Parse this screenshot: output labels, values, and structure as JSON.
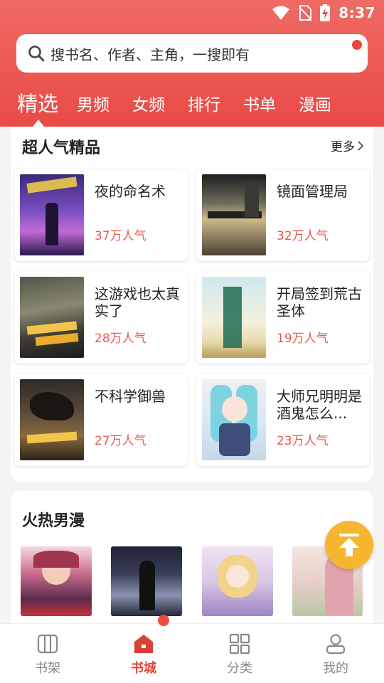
{
  "status_bar": {
    "time": "8:37",
    "icons": [
      "wifi-icon",
      "no-sim-icon",
      "battery-charging-icon"
    ]
  },
  "search": {
    "placeholder": "搜书名、作者、主角，一搜即有"
  },
  "tabs": [
    {
      "label": "精选",
      "active": true
    },
    {
      "label": "男频"
    },
    {
      "label": "女频"
    },
    {
      "label": "排行"
    },
    {
      "label": "书单"
    },
    {
      "label": "漫画"
    }
  ],
  "popular": {
    "title": "超人气精品",
    "more": "更多",
    "books": [
      {
        "title": "夜的命名术",
        "popularity": "37万人气"
      },
      {
        "title": "镜面管理局",
        "popularity": "32万人气"
      },
      {
        "title": "这游戏也太真实了",
        "popularity": "28万人气"
      },
      {
        "title": "开局签到荒古圣体",
        "popularity": "19万人气"
      },
      {
        "title": "不科学御兽",
        "popularity": "27万人气"
      },
      {
        "title": "大师兄明明是酒鬼怎么...",
        "popularity": "23万人气"
      }
    ]
  },
  "comics": {
    "title": "火热男漫"
  },
  "bottom_nav": [
    {
      "label": "书架",
      "icon": "bookshelf-icon"
    },
    {
      "label": "书城",
      "icon": "store-icon",
      "active": true
    },
    {
      "label": "分类",
      "icon": "category-grid-icon"
    },
    {
      "label": "我的",
      "icon": "profile-icon"
    }
  ],
  "colors": {
    "accent": "#e94a46",
    "popularity": "#e55a52",
    "fab": "#f6b631"
  }
}
